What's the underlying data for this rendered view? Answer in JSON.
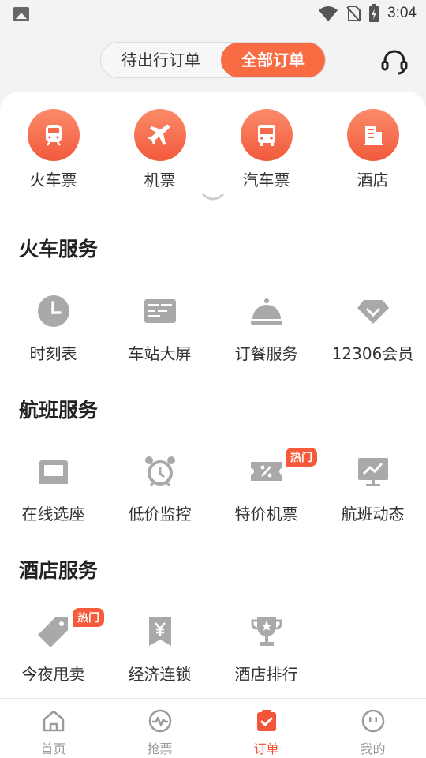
{
  "status_bar": {
    "time": "3:04"
  },
  "header": {
    "tab_upcoming": "待出行订单",
    "tab_all": "全部订单"
  },
  "categories": [
    {
      "label": "火车票",
      "icon": "train-icon"
    },
    {
      "label": "机票",
      "icon": "airplane-icon"
    },
    {
      "label": "汽车票",
      "icon": "bus-icon"
    },
    {
      "label": "酒店",
      "icon": "hotel-icon"
    }
  ],
  "train_services": {
    "title": "火车服务",
    "items": [
      {
        "label": "时刻表",
        "icon": "clock-icon"
      },
      {
        "label": "车站大屏",
        "icon": "board-icon"
      },
      {
        "label": "订餐服务",
        "icon": "cloche-icon"
      },
      {
        "label": "12306会员",
        "icon": "diamond-icon"
      }
    ]
  },
  "flight_services": {
    "title": "航班服务",
    "items": [
      {
        "label": "在线选座",
        "icon": "seat-icon"
      },
      {
        "label": "低价监控",
        "icon": "alarm-icon"
      },
      {
        "label": "特价机票",
        "icon": "coupon-icon",
        "badge": "热门"
      },
      {
        "label": "航班动态",
        "icon": "chart-icon"
      }
    ]
  },
  "hotel_services": {
    "title": "酒店服务",
    "items": [
      {
        "label": "今夜甩卖",
        "icon": "tag-icon",
        "badge": "热门"
      },
      {
        "label": "经济连锁",
        "icon": "yen-icon"
      },
      {
        "label": "酒店排行",
        "icon": "trophy-icon"
      }
    ]
  },
  "bottom_nav": [
    {
      "label": "首页",
      "icon": "home-icon"
    },
    {
      "label": "抢票",
      "icon": "pulse-icon"
    },
    {
      "label": "订单",
      "icon": "order-icon",
      "active": true
    },
    {
      "label": "我的",
      "icon": "profile-icon"
    }
  ],
  "colors": {
    "accent": "#f96b43",
    "icon_gray": "#a9a9a9",
    "text": "#333333"
  }
}
